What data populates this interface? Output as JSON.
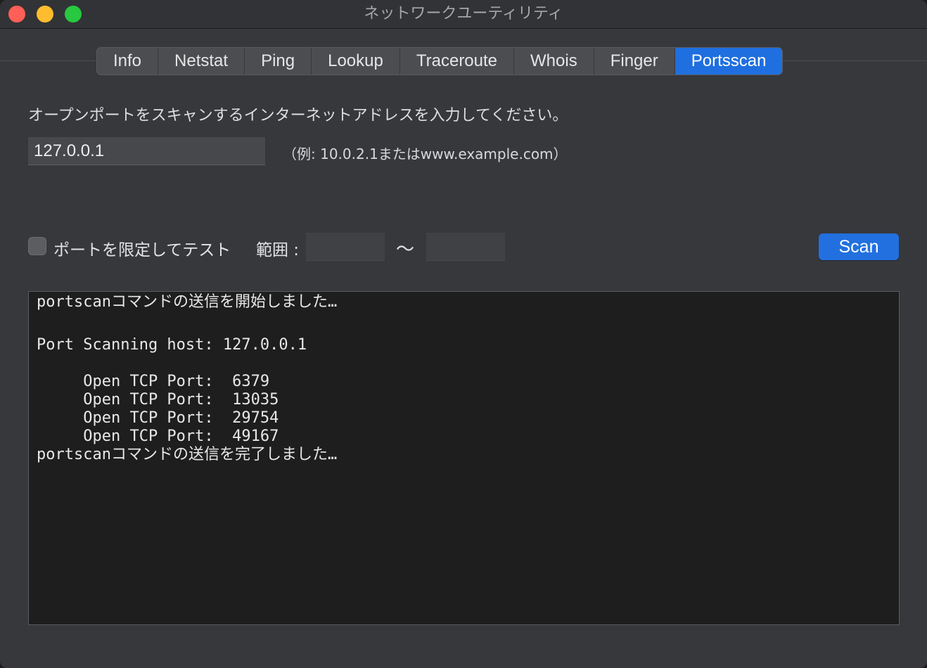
{
  "window": {
    "title": "ネットワークユーティリティ"
  },
  "tabs": [
    {
      "label": "Info",
      "active": false
    },
    {
      "label": "Netstat",
      "active": false
    },
    {
      "label": "Ping",
      "active": false
    },
    {
      "label": "Lookup",
      "active": false
    },
    {
      "label": "Traceroute",
      "active": false
    },
    {
      "label": "Whois",
      "active": false
    },
    {
      "label": "Finger",
      "active": false
    },
    {
      "label": "Portsscan",
      "active": true
    }
  ],
  "form": {
    "prompt": "オープンポートをスキャンするインターネットアドレスを入力してください。",
    "address_value": "127.0.0.1",
    "example_hint": "（例: 10.0.2.1またはwww.example.com）",
    "limit_ports_label": "ポートを限定してテスト",
    "limit_ports_checked": false,
    "range_label": "範囲 :",
    "range_from_value": "",
    "range_to_value": "",
    "range_separator": "〜",
    "scan_button_label": "Scan"
  },
  "output": {
    "lines": [
      "portscanコマンドの送信を開始しました…",
      "Port Scanning host: 127.0.0.1",
      "     Open TCP Port:  6379",
      "     Open TCP Port:  13035",
      "     Open TCP Port:  29754",
      "     Open TCP Port:  49167",
      "portscanコマンドの送信を完了しました…"
    ]
  },
  "colors": {
    "accent": "#1f6fe0",
    "window_bg": "#36383c",
    "console_bg": "#1e1e1e"
  }
}
